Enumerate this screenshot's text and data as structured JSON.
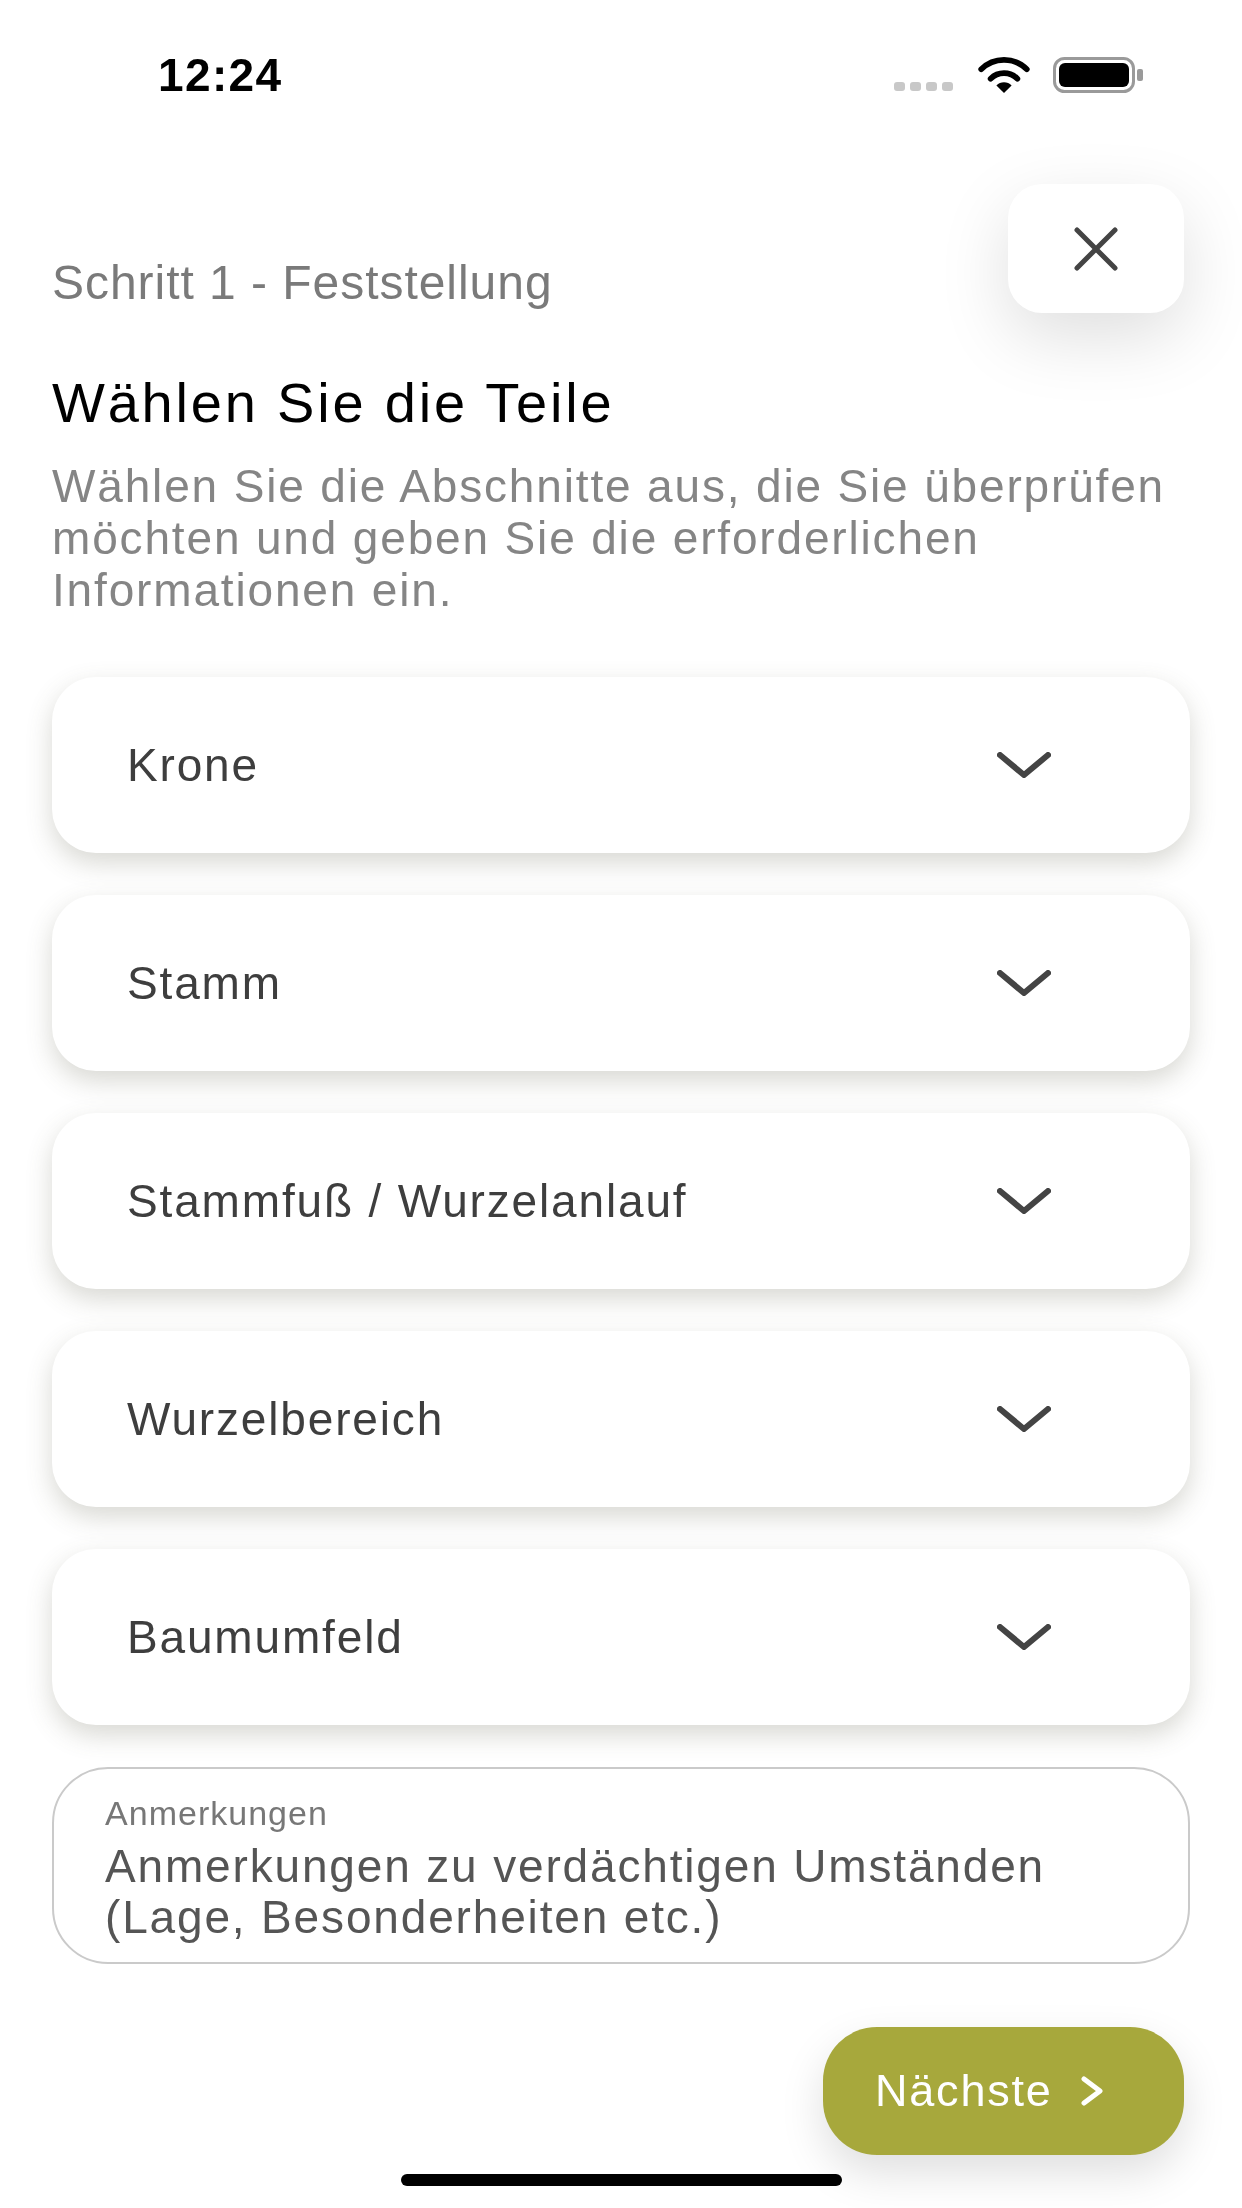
{
  "status_bar": {
    "time": "12:24"
  },
  "header": {
    "step": "Schritt 1 - Feststellung",
    "title": "Wählen Sie die Teile",
    "description": "Wählen Sie die Abschnitte aus, die Sie überprüfen möchten und geben Sie die erforderlichen Informationen ein."
  },
  "sections": [
    {
      "label": "Krone",
      "expanded": false
    },
    {
      "label": "Stamm",
      "expanded": false
    },
    {
      "label": "Stammfuß / Wurzelanlauf",
      "expanded": false
    },
    {
      "label": "Wurzelbereich",
      "expanded": false
    },
    {
      "label": "Baumumfeld",
      "expanded": false
    }
  ],
  "notes": {
    "label": "Anmerkungen",
    "placeholder": "Anmerkungen zu verdächtigen Umständen (Lage, Besonderheiten etc.)"
  },
  "next_button": {
    "label": "Nächste"
  }
}
